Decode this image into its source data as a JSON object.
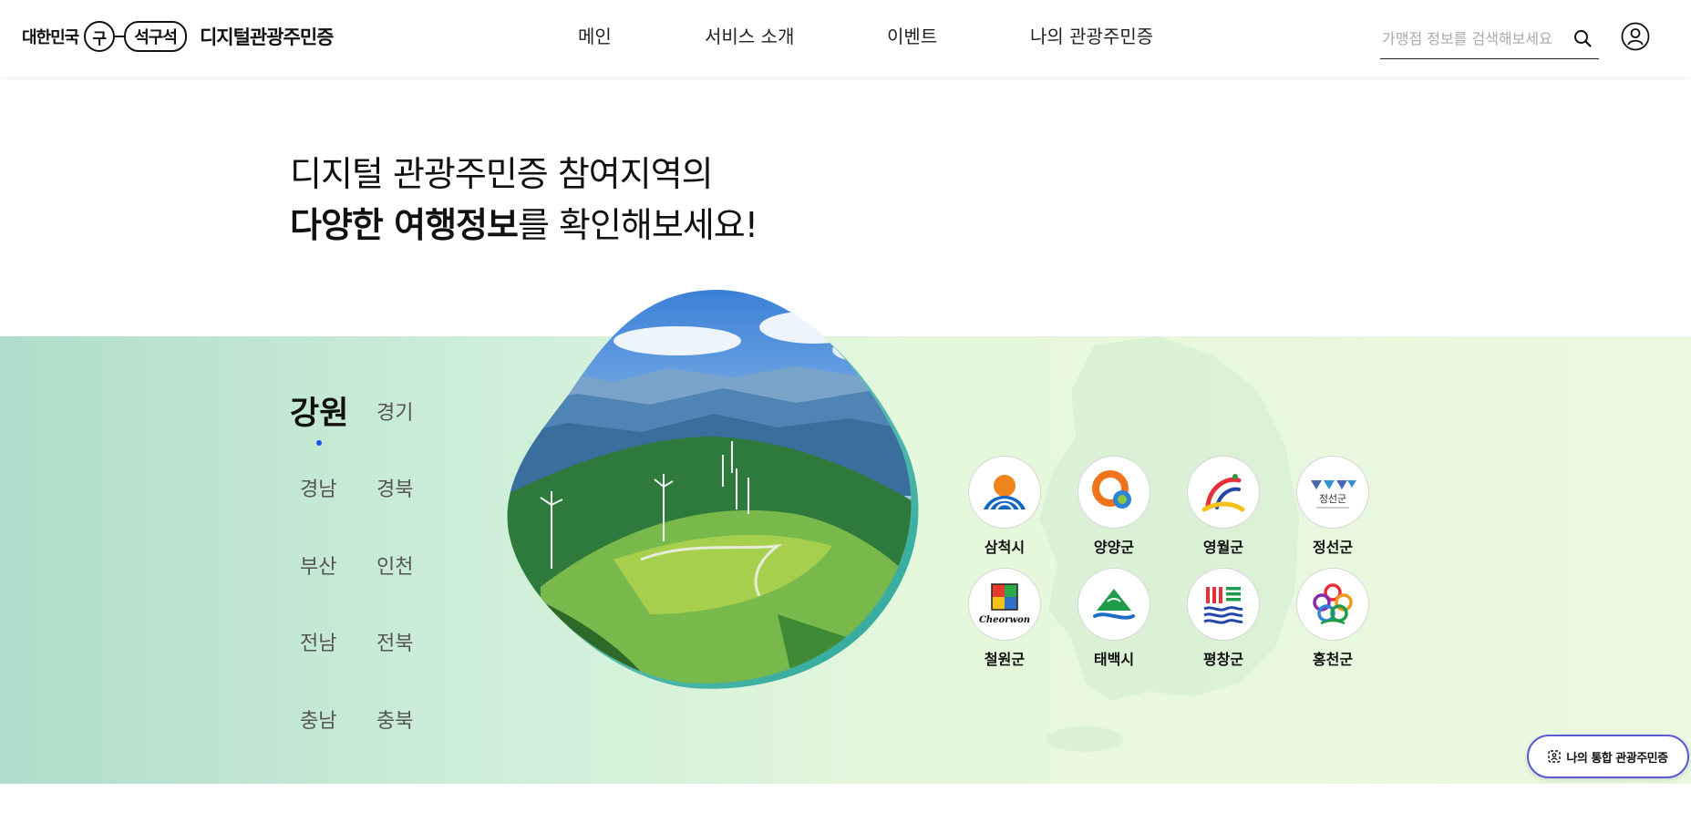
{
  "header": {
    "logo_prefix": "대한민국",
    "logo_circle": "구",
    "logo_pill": "석구석",
    "logo_name": "디지털관광주민증",
    "nav": [
      "메인",
      "서비스 소개",
      "이벤트",
      "나의 관광주민증"
    ],
    "search_placeholder": "가맹점 정보를 검색해보세요"
  },
  "hero": {
    "line1": "디지털 관광주민증 참여지역의",
    "line2_bold": "다양한 여행정보",
    "line2_rest": "를 확인해보세요!"
  },
  "regions": {
    "active": "강원",
    "items": [
      "강원",
      "경기",
      "경남",
      "경북",
      "부산",
      "인천",
      "전남",
      "전북",
      "충남",
      "충북"
    ]
  },
  "cities": [
    {
      "name": "삼척시",
      "icon": "samcheok-logo"
    },
    {
      "name": "양양군",
      "icon": "yangyang-logo"
    },
    {
      "name": "영월군",
      "icon": "yeongwol-logo"
    },
    {
      "name": "정선군",
      "icon": "jeongseon-logo",
      "logo_text": "정선군"
    },
    {
      "name": "철원군",
      "icon": "cheorwon-logo",
      "logo_text": "Cheorwon"
    },
    {
      "name": "태백시",
      "icon": "taebaek-logo"
    },
    {
      "name": "평창군",
      "icon": "pyeongchang-logo"
    },
    {
      "name": "홍천군",
      "icon": "hongcheon-logo"
    }
  ],
  "float_button": {
    "label": "나의 통합 관광주민증",
    "icon": "id-card-icon"
  },
  "colors": {
    "accent": "#1554f5",
    "band_left": "#b0dccb",
    "band_right": "#eaf9e0",
    "float_border": "#5b5bd6"
  }
}
